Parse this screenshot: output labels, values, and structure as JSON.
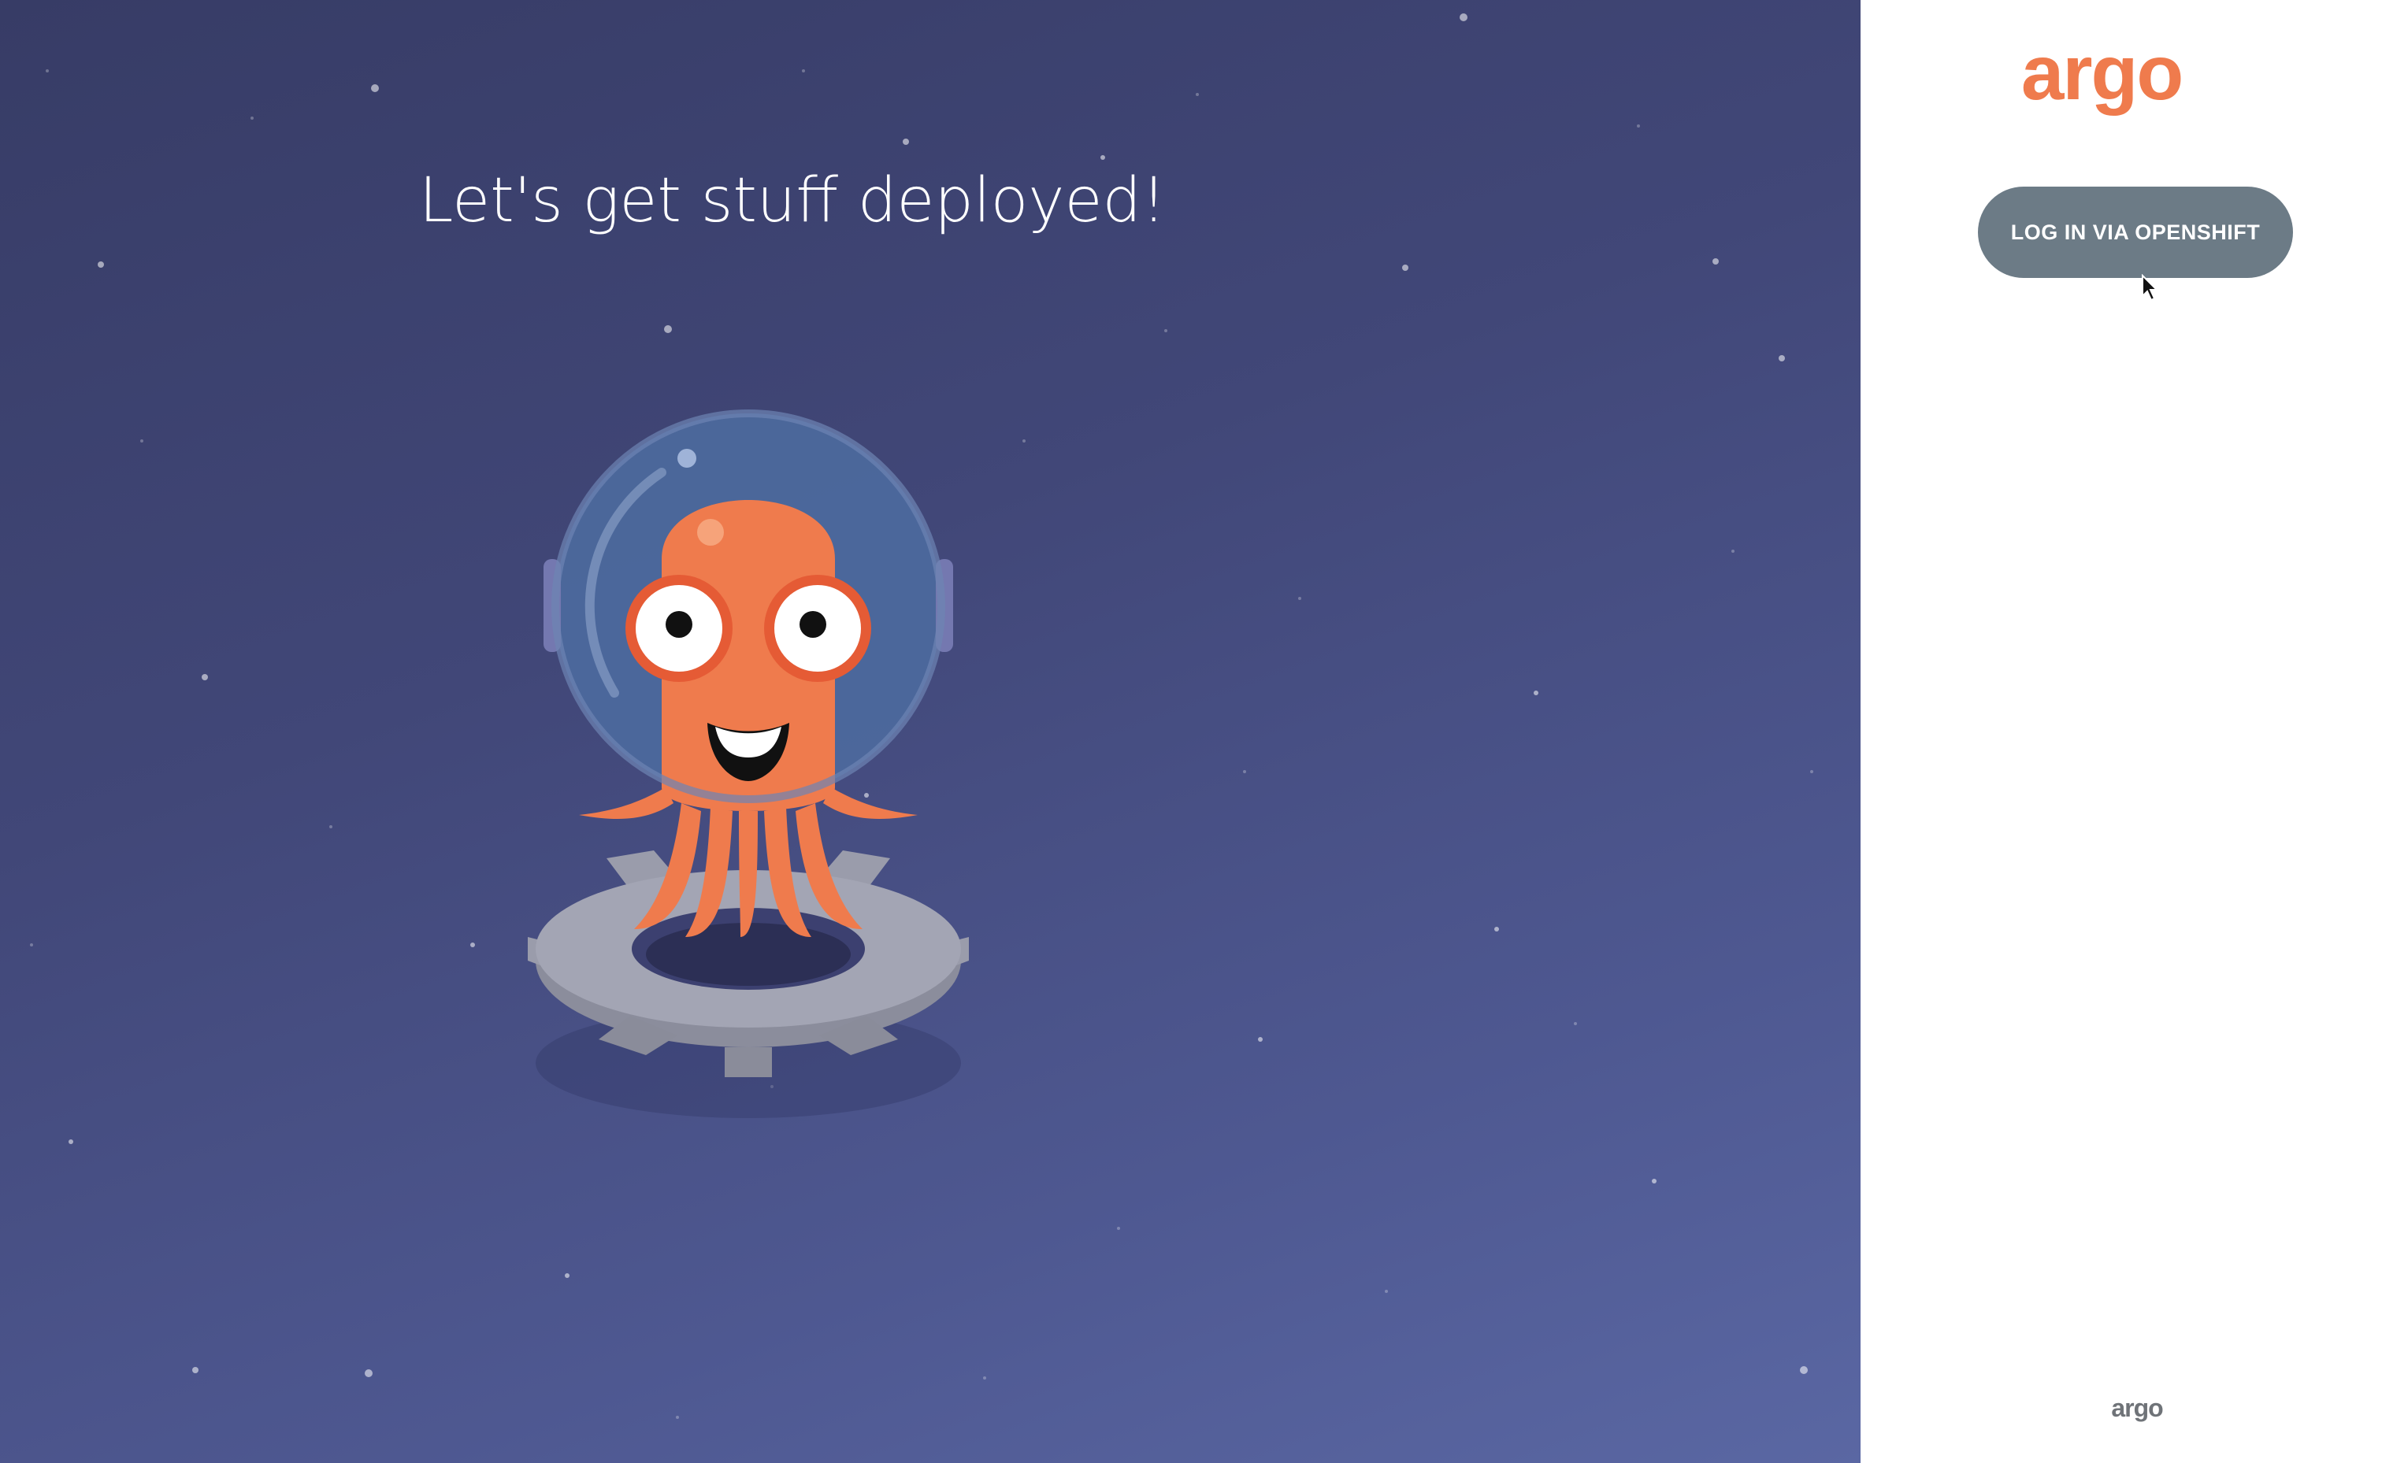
{
  "hero": {
    "title": "Let's get stuff deployed!"
  },
  "panel": {
    "logo_text": "argo",
    "login_button_label": "LOG IN VIA OPENSHIFT",
    "footer_logo_text": "argo"
  },
  "colors": {
    "brand_orange": "#ef7b4d",
    "button_gray": "#6c7b86",
    "hero_bg_top": "#373c66",
    "hero_bg_bottom": "#5a67a3",
    "footer_logo_gray": "#6f7378"
  },
  "icons": {
    "mascot": "argo-octopus-astronaut-illustration",
    "cursor": "mouse-pointer-icon"
  }
}
